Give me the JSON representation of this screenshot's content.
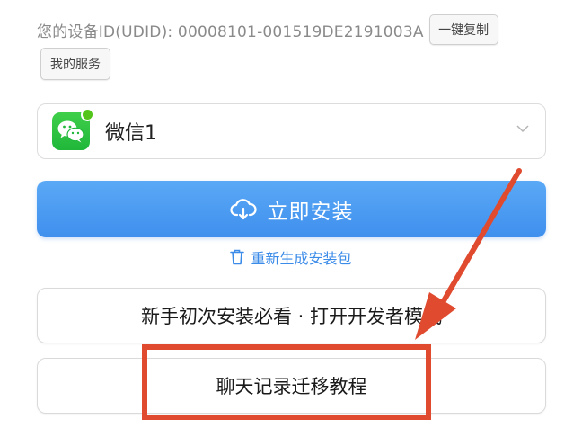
{
  "device": {
    "udid_text": "您的设备ID(UDID): 00008101-001519DE2191003A",
    "copy_label": "一键复制",
    "service_label": "我的服务"
  },
  "app_select": {
    "name": "微信1",
    "icon": "wechat-icon"
  },
  "install": {
    "label": "立即安装",
    "icon": "cloud-download-icon"
  },
  "regen": {
    "label": "重新生成安装包",
    "icon": "trash-icon"
  },
  "guides": [
    {
      "label": "新手初次安装必看 · 打开开发者模式"
    },
    {
      "label": "聊天记录迁移教程"
    }
  ],
  "colors": {
    "accent": "#3f8fee",
    "annotation": "#e04a2f",
    "wechat": "#2dc100"
  }
}
